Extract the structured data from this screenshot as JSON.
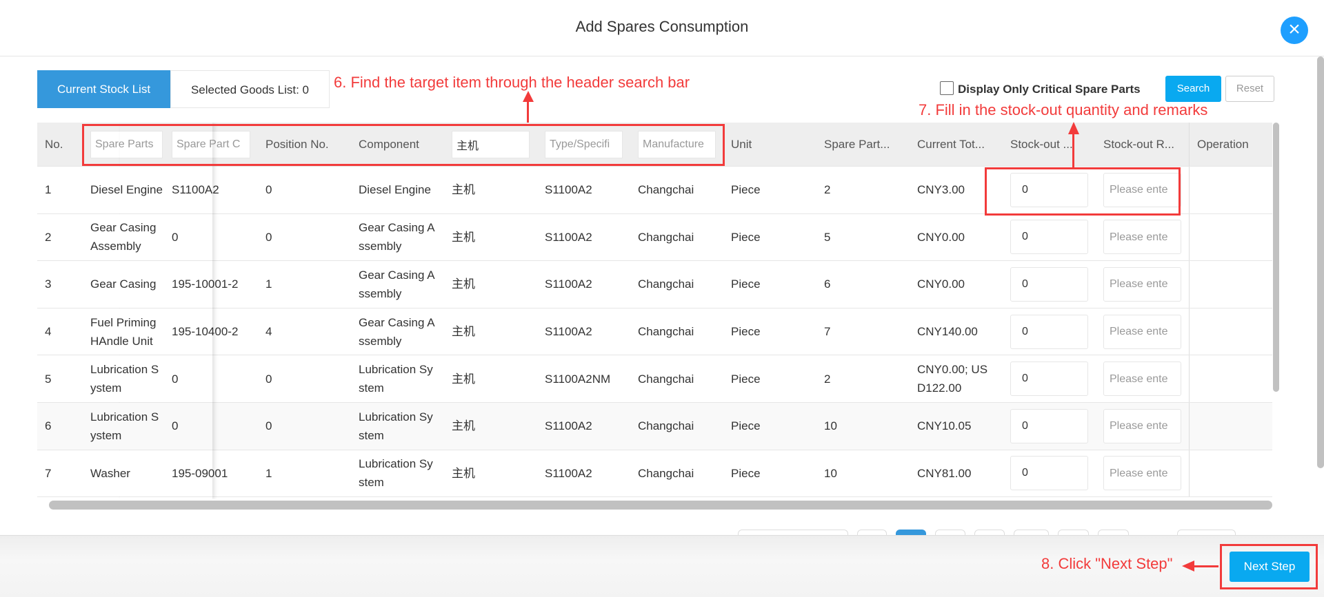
{
  "dialog": {
    "title": "Add Spares Consumption",
    "close_icon": "close-icon"
  },
  "tabs": [
    {
      "label": "Current Stock List",
      "active": true
    },
    {
      "label": "Selected Goods List: 0",
      "active": false
    }
  ],
  "filters": {
    "critical_only_label": "Display Only Critical Spare Parts",
    "critical_only_checked": false,
    "search_label": "Search",
    "reset_label": "Reset"
  },
  "table": {
    "headers": {
      "no": "No.",
      "spare_parts_placeholder": "Spare Parts",
      "spare_part_code_placeholder": "Spare Part C",
      "position": "Position No.",
      "component": "Component",
      "equipment_value": "主机",
      "type_placeholder": "Type/Specifi",
      "manufacturer_placeholder": "Manufacture",
      "unit": "Unit",
      "qty": "Spare Part...",
      "total": "Current Tot...",
      "stockout_qty": "Stock-out ...",
      "stockout_remarks": "Stock-out R...",
      "operation": "Operation"
    },
    "rows": [
      {
        "no": "1",
        "name": "Diesel Engine",
        "code": "S1100A2",
        "position": "0",
        "component": "Diesel Engine",
        "equipment": "主机",
        "type": "S1100A2",
        "manufacturer": "Changchai",
        "unit": "Piece",
        "qty": "2",
        "total": "CNY3.00",
        "stockout_qty": "0",
        "remarks_placeholder": "Please ente"
      },
      {
        "no": "2",
        "name": "Gear Casing Assembly",
        "code": "0",
        "position": "0",
        "component": "Gear Casing Assembly",
        "equipment": "主机",
        "type": "S1100A2",
        "manufacturer": "Changchai",
        "unit": "Piece",
        "qty": "5",
        "total": "CNY0.00",
        "stockout_qty": "0",
        "remarks_placeholder": "Please ente"
      },
      {
        "no": "3",
        "name": "Gear Casing",
        "code": "195-10001-2",
        "position": "1",
        "component": "Gear Casing Assembly",
        "equipment": "主机",
        "type": "S1100A2",
        "manufacturer": "Changchai",
        "unit": "Piece",
        "qty": "6",
        "total": "CNY0.00",
        "stockout_qty": "0",
        "remarks_placeholder": "Please ente"
      },
      {
        "no": "4",
        "name": "Fuel Priming HAndle Unit",
        "code": "195-10400-2",
        "position": "4",
        "component": "Gear Casing Assembly",
        "equipment": "主机",
        "type": "S1100A2",
        "manufacturer": "Changchai",
        "unit": "Piece",
        "qty": "7",
        "total": "CNY140.00",
        "stockout_qty": "0",
        "remarks_placeholder": "Please ente"
      },
      {
        "no": "5",
        "name": "Lubrication System",
        "code": "0",
        "position": "0",
        "component": "Lubrication System",
        "equipment": "主机",
        "type": "S1100A2NM",
        "manufacturer": "Changchai",
        "unit": "Piece",
        "qty": "2",
        "total": "CNY0.00; USD122.00",
        "stockout_qty": "0",
        "remarks_placeholder": "Please ente"
      },
      {
        "no": "6",
        "name": "Lubrication System",
        "code": "0",
        "position": "0",
        "component": "Lubrication System",
        "equipment": "主机",
        "type": "S1100A2",
        "manufacturer": "Changchai",
        "unit": "Piece",
        "qty": "10",
        "total": "CNY10.05",
        "stockout_qty": "0",
        "remarks_placeholder": "Please ente"
      },
      {
        "no": "7",
        "name": "Washer",
        "code": "195-09001",
        "position": "1",
        "component": "Lubrication System",
        "equipment": "主机",
        "type": "S1100A2",
        "manufacturer": "Changchai",
        "unit": "Piece",
        "qty": "10",
        "total": "CNY81.00",
        "stockout_qty": "0",
        "remarks_placeholder": "Please ente"
      }
    ]
  },
  "pagination": {
    "active_page_color": "#3598dc"
  },
  "footer": {
    "next_label": "Next Step"
  },
  "annotations": {
    "step6": "6. Find the target item through the header search bar",
    "step7": "7. Fill in the stock-out quantity and remarks",
    "step8": "8. Click \"Next Step\"",
    "color": "#f23b3b"
  }
}
